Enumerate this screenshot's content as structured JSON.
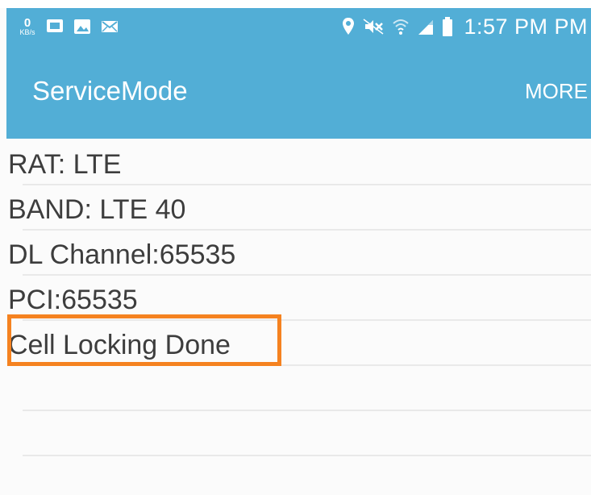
{
  "status_bar": {
    "kbs_value": "0",
    "kbs_unit": "KB/s",
    "time": "1:57 PM PM",
    "icons": [
      "network-speed-icon",
      "message-icon",
      "gallery-icon",
      "mail-icon",
      "location-icon",
      "mute-icon",
      "wifi-icon",
      "signal-icon",
      "battery-icon"
    ]
  },
  "app_bar": {
    "title": "ServiceMode",
    "more_label": "MORE",
    "background_color": "#52aed6"
  },
  "list": {
    "items": [
      "RAT: LTE",
      "BAND: LTE 40",
      "DL Channel:65535",
      "PCI:65535",
      "Cell Locking Done"
    ],
    "highlight_color": "#f58220"
  }
}
